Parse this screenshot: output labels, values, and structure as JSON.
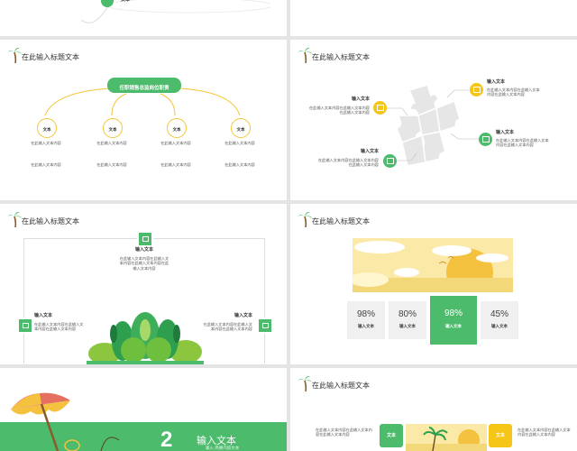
{
  "slide1": {
    "fragment": "文本"
  },
  "slide3": {
    "title": "在此输入标题文本",
    "root_label": "任职销售总监岗位职责",
    "nodes": [
      {
        "label": "文本",
        "line1": "在此输入文本内容",
        "line2": "在此输入文本内容"
      },
      {
        "label": "文本",
        "line1": "在此输入文本内容",
        "line2": "在此输入文本内容"
      },
      {
        "label": "文本",
        "line1": "在此输入文本内容",
        "line2": "在此输入文本内容"
      },
      {
        "label": "文本",
        "line1": "在此输入文本内容",
        "line2": "在此输入文本内容"
      }
    ]
  },
  "slide4": {
    "title": "在此输入标题文本",
    "items": [
      {
        "heading": "输入文本",
        "body": "在此输入文本内容在此输入文本内容在此输入文本内容"
      },
      {
        "heading": "输入文本",
        "body": "在此输入文本内容在此输入文本内容在此输入文本内容"
      },
      {
        "heading": "输入文本",
        "body": "在此输入文本内容在此输入文本内容在此输入文本内容"
      },
      {
        "heading": "输入文本",
        "body": "在此输入文本内容在此输入文本内容在此输入文本内容"
      }
    ]
  },
  "slide5": {
    "title": "在此输入标题文本",
    "items": [
      {
        "heading": "输入文本",
        "body": "在此输入文本内容在此输入文本内容在此输入文本内容在此输入文本内容"
      },
      {
        "heading": "输入文本",
        "body": "在此输入文本内容在此输入文本内容在此输入文本内容"
      },
      {
        "heading": "输入文本",
        "body": "在此输入文本内容在此输入文本内容在此输入文本内容"
      }
    ]
  },
  "slide6": {
    "title": "在此输入标题文本",
    "stats": [
      {
        "value": "98%",
        "label": "输入文本"
      },
      {
        "value": "80%",
        "label": "输入文本"
      },
      {
        "value": "98%",
        "label": "输入文本"
      },
      {
        "value": "45%",
        "label": "输入文本"
      }
    ]
  },
  "slide7": {
    "number": "2",
    "title": "输入文本",
    "subtitle": "输入 简要内容文本"
  },
  "slide8": {
    "title": "在此输入标题文本",
    "left_text": "在此输入文本内容在此输入文本内容在此输入文本内容",
    "box1": "文本",
    "box2": "文本",
    "right_text": "在此输入文本内容在此输入文本内容在此输入文本内容"
  },
  "colors": {
    "green": "#4cbb6c",
    "yellow": "#f5c518",
    "light_gray": "#f0f0f0"
  }
}
